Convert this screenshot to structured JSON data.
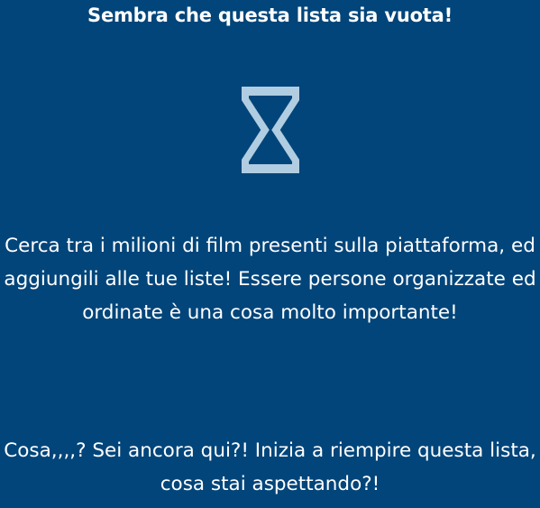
{
  "empty_list": {
    "title": "Sembra che questa lista sia vuota!",
    "icon": "hourglass-icon",
    "icon_color": "#b1cde1",
    "background_color": "#02457a",
    "message_1": "Cerca tra i milioni di film presenti sulla piattaforma, ed aggiungili alle tue liste! Essere persone organizzate ed ordinate è una cosa molto importante!",
    "message_2": "Cosa,,,,? Sei ancora qui?! Inizia a riempire questa lista, cosa stai aspettando?!"
  }
}
